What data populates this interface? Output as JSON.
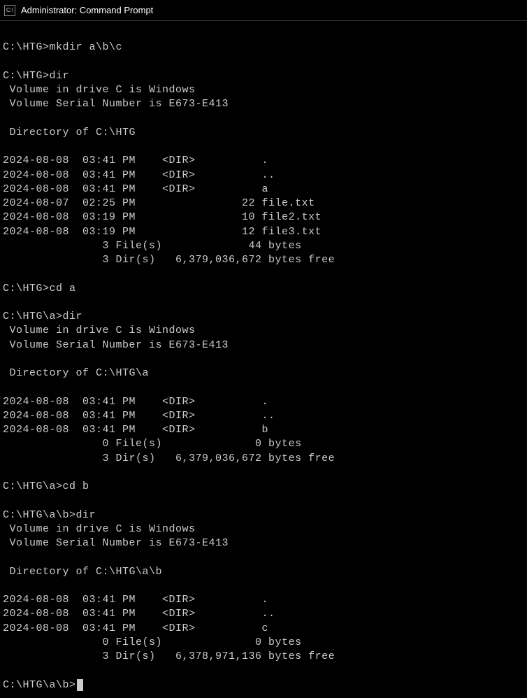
{
  "titlebar": {
    "icon_text": "C:\\",
    "title": "Administrator: Command Prompt"
  },
  "terminal": {
    "lines": [
      "",
      "C:\\HTG>mkdir a\\b\\c",
      "",
      "C:\\HTG>dir",
      " Volume in drive C is Windows",
      " Volume Serial Number is E673-E413",
      "",
      " Directory of C:\\HTG",
      "",
      "2024-08-08  03:41 PM    <DIR>          .",
      "2024-08-08  03:41 PM    <DIR>          ..",
      "2024-08-08  03:41 PM    <DIR>          a",
      "2024-08-07  02:25 PM                22 file.txt",
      "2024-08-08  03:19 PM                10 file2.txt",
      "2024-08-08  03:19 PM                12 file3.txt",
      "               3 File(s)             44 bytes",
      "               3 Dir(s)   6,379,036,672 bytes free",
      "",
      "C:\\HTG>cd a",
      "",
      "C:\\HTG\\a>dir",
      " Volume in drive C is Windows",
      " Volume Serial Number is E673-E413",
      "",
      " Directory of C:\\HTG\\a",
      "",
      "2024-08-08  03:41 PM    <DIR>          .",
      "2024-08-08  03:41 PM    <DIR>          ..",
      "2024-08-08  03:41 PM    <DIR>          b",
      "               0 File(s)              0 bytes",
      "               3 Dir(s)   6,379,036,672 bytes free",
      "",
      "C:\\HTG\\a>cd b",
      "",
      "C:\\HTG\\a\\b>dir",
      " Volume in drive C is Windows",
      " Volume Serial Number is E673-E413",
      "",
      " Directory of C:\\HTG\\a\\b",
      "",
      "2024-08-08  03:41 PM    <DIR>          .",
      "2024-08-08  03:41 PM    <DIR>          ..",
      "2024-08-08  03:41 PM    <DIR>          c",
      "               0 File(s)              0 bytes",
      "               3 Dir(s)   6,378,971,136 bytes free",
      "",
      "C:\\HTG\\a\\b>"
    ]
  }
}
